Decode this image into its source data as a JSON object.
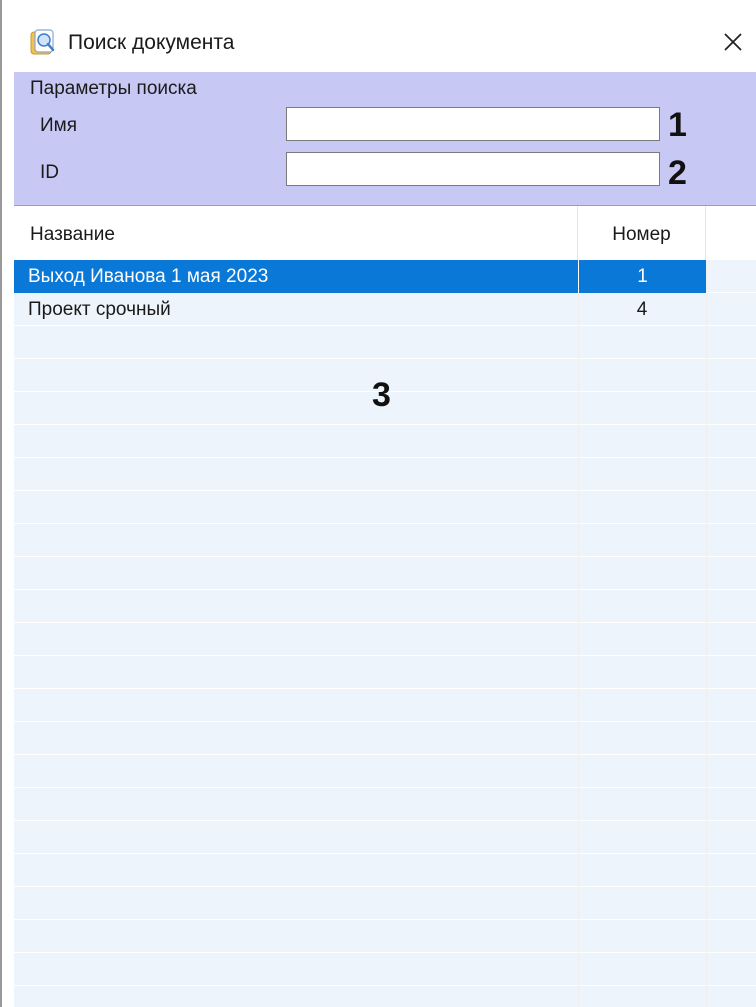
{
  "window": {
    "title": "Поиск документа",
    "icon": "document-search-icon",
    "close_icon": "close-icon"
  },
  "search_params": {
    "group_title": "Параметры поиска",
    "name_label": "Имя",
    "name_value": "",
    "id_label": "ID",
    "id_value": ""
  },
  "callouts": {
    "one": "1",
    "two": "2",
    "three": "3"
  },
  "list": {
    "columns": {
      "name": "Название",
      "number": "Номер"
    },
    "rows": [
      {
        "name": "Выход Иванова 1 мая 2023",
        "number": "1",
        "selected": true
      },
      {
        "name": "Проект срочный",
        "number": "4",
        "selected": false
      }
    ]
  },
  "colors": {
    "selection": "#0a78d7",
    "panel_background": "#c8c8f5"
  }
}
